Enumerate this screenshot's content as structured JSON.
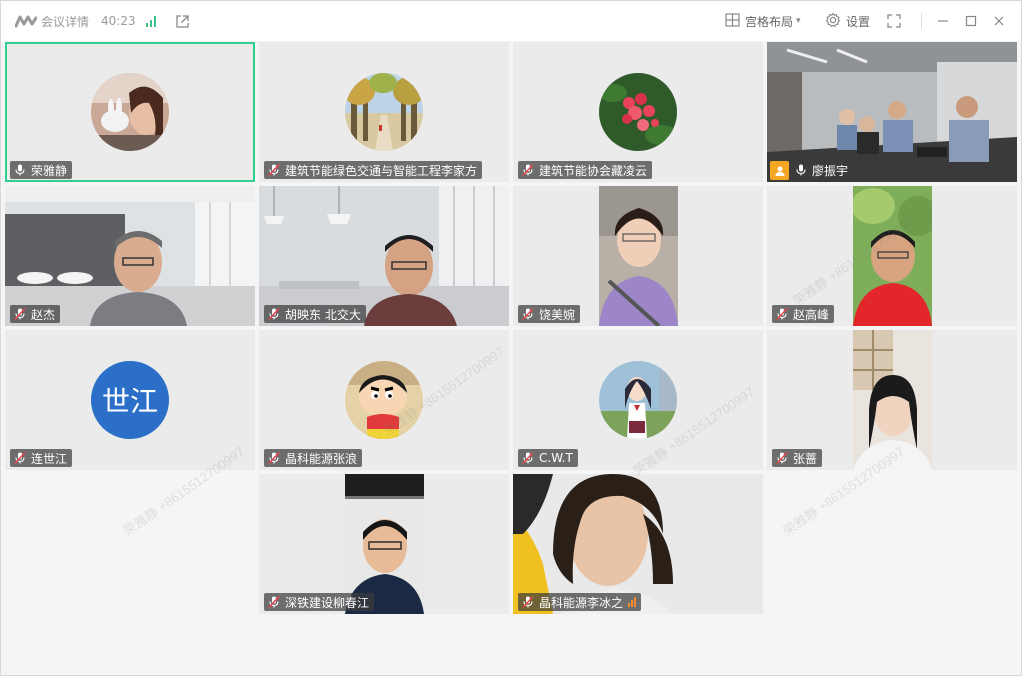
{
  "titlebar": {
    "meeting_info": "会议详情",
    "timer": "40:23",
    "layout_label": "宫格布局",
    "settings_label": "设置"
  },
  "watermark": "荣雅静 +8615512700997",
  "participants": [
    {
      "name": "荣雅静",
      "mic": "on",
      "active": true
    },
    {
      "name": "建筑节能绿色交通与智能工程李家方",
      "mic": "muted"
    },
    {
      "name": "建筑节能协会藏凌云",
      "mic": "muted"
    },
    {
      "name": "廖振宇",
      "mic": "on",
      "host": true
    },
    {
      "name": "赵杰",
      "mic": "muted"
    },
    {
      "name": "胡映东 北交大",
      "mic": "muted"
    },
    {
      "name": "饶美婉",
      "mic": "muted"
    },
    {
      "name": "赵高峰",
      "mic": "muted"
    },
    {
      "name": "连世江",
      "mic": "muted",
      "initials": "世江",
      "avatar_color": "#2b6fc9"
    },
    {
      "name": "晶科能源张浪",
      "mic": "muted"
    },
    {
      "name": "C.W.T",
      "mic": "muted"
    },
    {
      "name": "张蔷",
      "mic": "muted"
    },
    {
      "name": "深铁建设柳春江",
      "mic": "muted"
    },
    {
      "name": "晶科能源李冰之",
      "mic": "muted",
      "speaking": true
    }
  ],
  "colors": {
    "active_border": "#2fcf8f",
    "host_badge": "#f5a623",
    "mute_red": "#e5484d"
  }
}
